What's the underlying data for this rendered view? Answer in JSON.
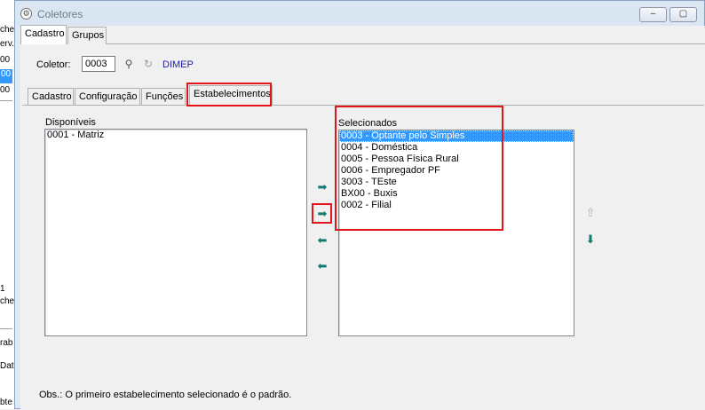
{
  "background_app": {
    "fragments": [
      "che",
      "erv.",
      "00",
      "00",
      "00",
      "1",
      "che",
      "rab",
      "Dat",
      "bte"
    ]
  },
  "window": {
    "title": "Coletores",
    "icon": "gear-icon",
    "buttons": {
      "minimize": "‒",
      "maximize": "▢",
      "close": "✕"
    }
  },
  "top_tabs": [
    "Cadastro",
    "Grupos"
  ],
  "coletor": {
    "label": "Coletor:",
    "value": "0003",
    "search_icon": "search-user-icon",
    "refresh_icon": "refresh-icon",
    "name": "DIMEP"
  },
  "inner_tabs": [
    "Cadastro",
    "Configuração",
    "Funções",
    "Estabelecimentos"
  ],
  "active_inner_tab": "Estabelecimentos",
  "disponiveis": {
    "label": "Disponíveis",
    "items": [
      "0001 - Matriz"
    ]
  },
  "selecionados": {
    "label": "Selecionados",
    "items": [
      "0003 - Optante pelo Simples",
      "0004 - Doméstica",
      "0005 - Pessoa Física Rural",
      "0006 - Empregador PF",
      "3003 - TEste",
      "BX00 - Buxis",
      "0002 - Filial"
    ],
    "selected_index": 0
  },
  "transfer_buttons": {
    "add_all": "➡",
    "add": "➡",
    "remove": "⬅",
    "remove_all": "⬅"
  },
  "order_buttons": {
    "up": "⇧",
    "down": "⬇"
  },
  "highlight_color": "#e3141b",
  "selection_color": "#3399ff",
  "obs": "Obs.: O primeiro estabelecimento selecionado é o padrão."
}
